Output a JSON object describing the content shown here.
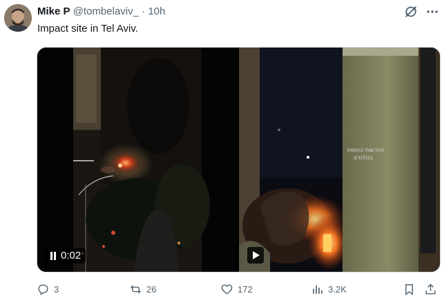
{
  "tweet": {
    "name": "Mike P",
    "handle": "@tombelaviv_",
    "separator": "·",
    "time": "10h",
    "text": "Impact site in Tel Aviv."
  },
  "media": {
    "video1": {
      "timestamp": "0:02",
      "state": "playing"
    },
    "video2": {
      "state": "paused",
      "watermark_line1": "החדשות החמות",
      "watermark_line2": "בטלגרם"
    }
  },
  "actions": {
    "replies": "3",
    "reposts": "26",
    "likes": "172",
    "views": "3.2K"
  },
  "icons": {
    "reply": "reply-icon",
    "repost": "repost-icon",
    "like": "heart-icon",
    "views": "views-icon",
    "bookmark": "bookmark-icon",
    "share": "share-icon",
    "grok": "grok-icon",
    "more": "more-icon"
  }
}
